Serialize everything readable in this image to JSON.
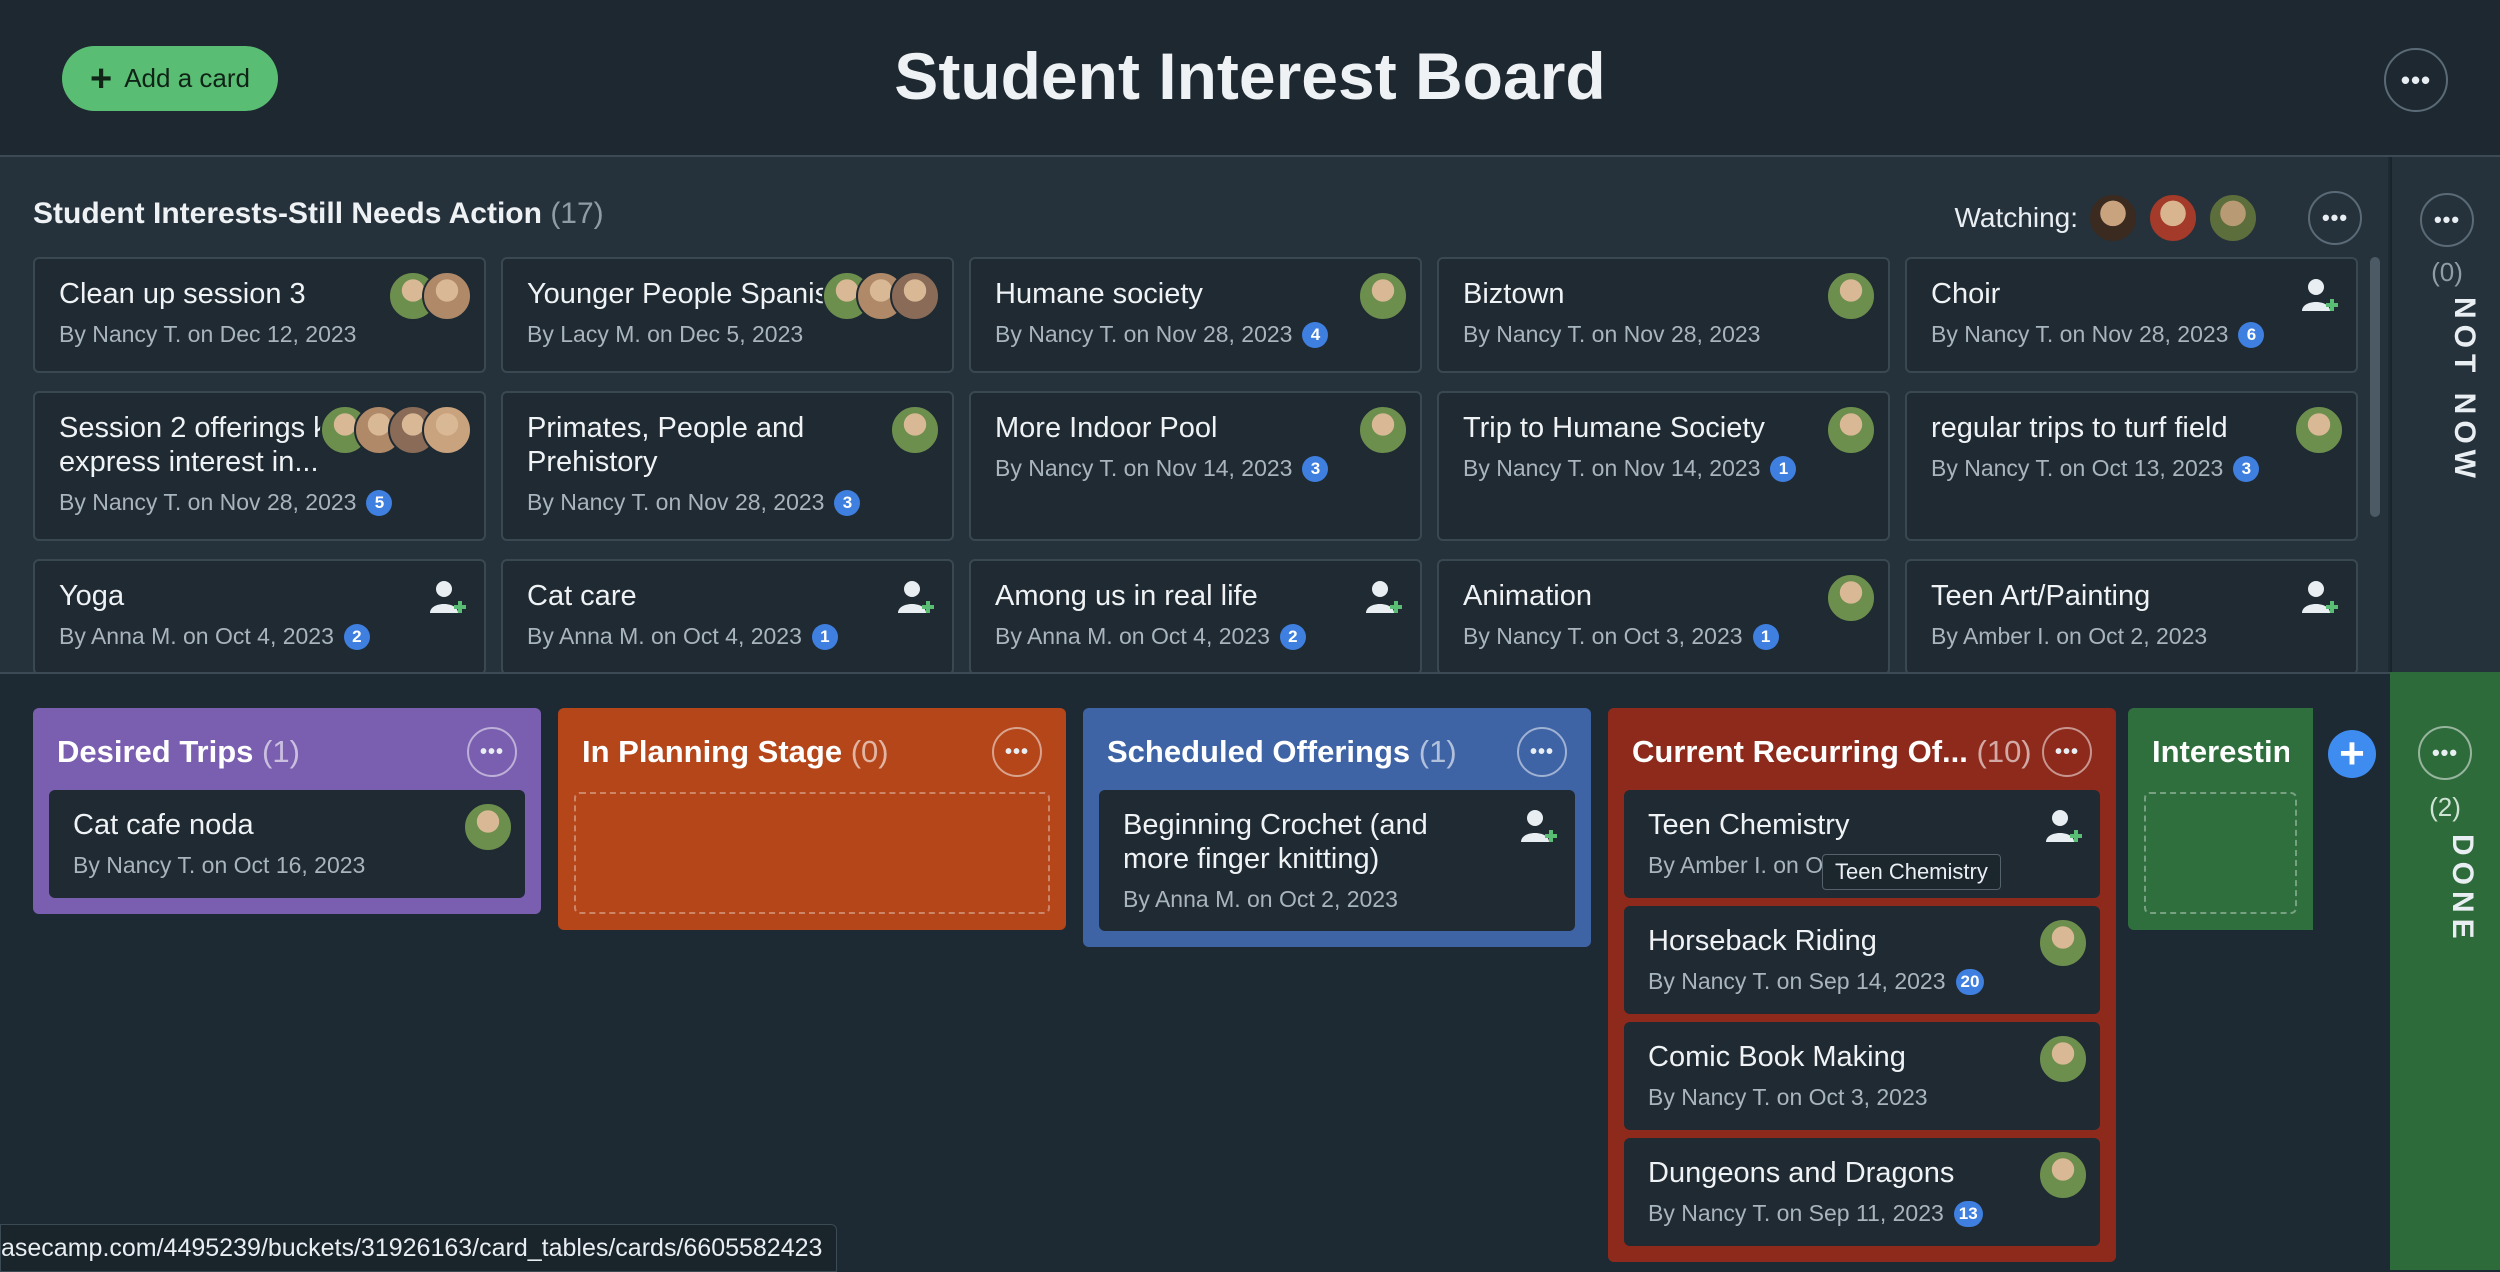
{
  "header": {
    "add_card_label": "Add a card",
    "title": "Student Interest Board"
  },
  "needs_action": {
    "title": "Student Interests-Still Needs Action",
    "count": "(17)",
    "watching_label": "Watching:",
    "cards": [
      {
        "title": "Clean up session 3",
        "meta": "By Nancy T. on Dec 12, 2023",
        "badge": "",
        "avatars": 2,
        "assign": false
      },
      {
        "title": "Younger People Spanish",
        "meta": "By Lacy M. on Dec 5, 2023",
        "badge": "",
        "avatars": 3,
        "assign": false
      },
      {
        "title": "Humane society",
        "meta": "By Nancy T. on Nov 28, 2023",
        "badge": "4",
        "avatars": 1,
        "assign": false
      },
      {
        "title": "Biztown",
        "meta": "By Nancy T. on Nov 28, 2023",
        "badge": "",
        "avatars": 1,
        "assign": false
      },
      {
        "title": "Choir",
        "meta": "By Nancy T. on Nov 28, 2023",
        "badge": "6",
        "avatars": 0,
        "assign": true
      },
      {
        "title": "Session 2 offerings kids express interest in...",
        "meta": "By Nancy T. on Nov 28, 2023",
        "badge": "5",
        "avatars": 4,
        "assign": false
      },
      {
        "title": "Primates, People and Prehistory",
        "meta": "By Nancy T. on Nov 28, 2023",
        "badge": "3",
        "avatars": 1,
        "assign": false
      },
      {
        "title": "More Indoor Pool",
        "meta": "By Nancy T. on Nov 14, 2023",
        "badge": "3",
        "avatars": 1,
        "assign": false
      },
      {
        "title": "Trip to Humane Society",
        "meta": "By Nancy T. on Nov 14, 2023",
        "badge": "1",
        "avatars": 1,
        "assign": false
      },
      {
        "title": "regular trips to turf field",
        "meta": "By Nancy T. on Oct 13, 2023",
        "badge": "3",
        "avatars": 1,
        "assign": false
      },
      {
        "title": "Yoga",
        "meta": "By Anna M. on Oct 4, 2023",
        "badge": "2",
        "avatars": 0,
        "assign": true
      },
      {
        "title": "Cat care",
        "meta": "By Anna M. on Oct 4, 2023",
        "badge": "1",
        "avatars": 0,
        "assign": true
      },
      {
        "title": "Among us in real life",
        "meta": "By Anna M. on Oct 4, 2023",
        "badge": "2",
        "avatars": 0,
        "assign": true
      },
      {
        "title": "Animation",
        "meta": "By Nancy T. on Oct 3, 2023",
        "badge": "1",
        "avatars": 1,
        "assign": false
      },
      {
        "title": "Teen Art/Painting",
        "meta": "By Amber I. on Oct 2, 2023",
        "badge": "",
        "avatars": 0,
        "assign": true
      }
    ]
  },
  "not_now": {
    "count": "(0)",
    "label": "NOT NOW"
  },
  "done": {
    "count": "(2)",
    "label": "DONE"
  },
  "columns": [
    {
      "title": "Desired Trips",
      "count": "(1)",
      "color": "#7a5fb0",
      "cards": [
        {
          "title": "Cat cafe noda",
          "meta": "By Nancy T. on Oct 16, 2023",
          "badge": "",
          "avatars": 1,
          "assign": false
        }
      ]
    },
    {
      "title": "In Planning Stage",
      "count": "(0)",
      "color": "#b4461a",
      "cards": []
    },
    {
      "title": "Scheduled Offerings",
      "count": "(1)",
      "color": "#3f64a6",
      "cards": [
        {
          "title": "Beginning Crochet (and more finger knitting)",
          "meta": "By Anna M. on Oct 2, 2023",
          "badge": "",
          "avatars": 0,
          "assign": true
        }
      ]
    },
    {
      "title": "Current Recurring Of...",
      "count": "(10)",
      "color": "#8e2a1c",
      "cards": [
        {
          "title": "Teen Chemistry",
          "meta": "By Amber I. on O",
          "badge": "",
          "avatars": 0,
          "assign": true
        },
        {
          "title": "Horseback Riding",
          "meta": "By Nancy T. on Sep 14, 2023",
          "badge": "20",
          "avatars": 1,
          "assign": false
        },
        {
          "title": "Comic Book Making",
          "meta": "By Nancy T. on Oct 3, 2023",
          "badge": "",
          "avatars": 1,
          "assign": false
        },
        {
          "title": "Dungeons and Dragons",
          "meta": "By Nancy T. on Sep 11, 2023",
          "badge": "13",
          "avatars": 1,
          "assign": false
        }
      ]
    },
    {
      "title": "Interesting I",
      "count": "",
      "color": "#2f6f3e",
      "cards": []
    }
  ],
  "tooltip": "Teen Chemistry",
  "status_url": "asecamp.com/4495239/buckets/31926163/card_tables/cards/6605582423",
  "colors": {
    "avatar_palette": [
      "#6d8f4e",
      "#b08968",
      "#8a6b57",
      "#c9a27e",
      "#7f9a62"
    ]
  }
}
